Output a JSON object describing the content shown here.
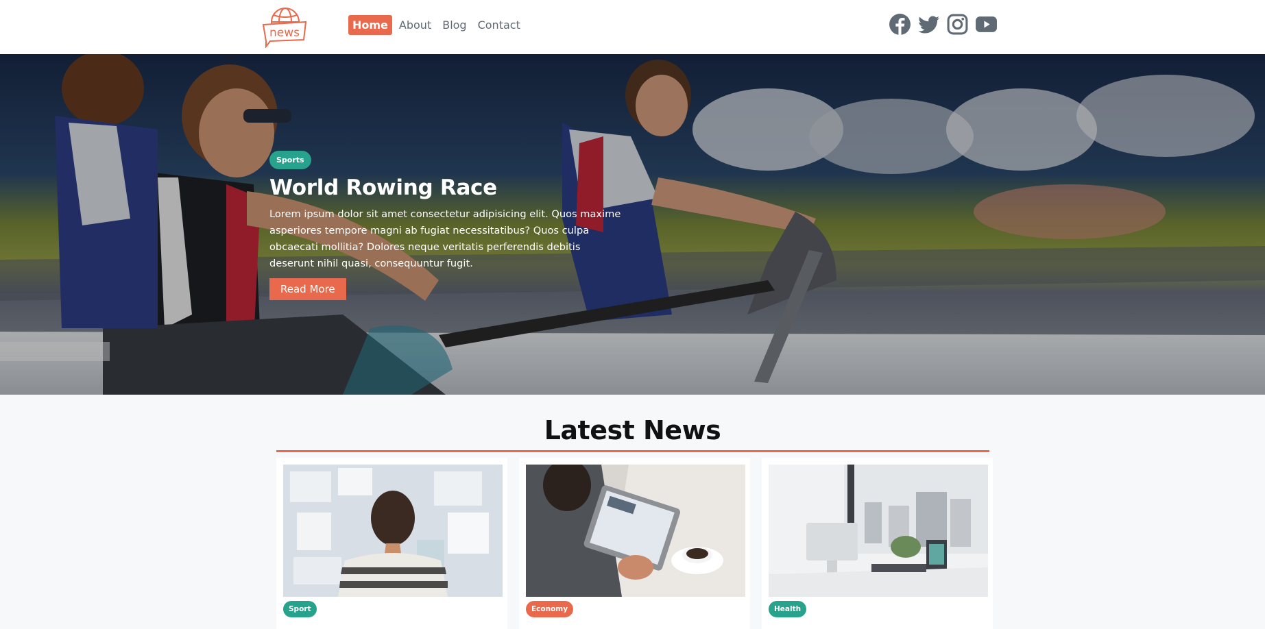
{
  "header": {
    "logo_text": "news",
    "nav": [
      {
        "label": "Home",
        "active": true
      },
      {
        "label": "About",
        "active": false
      },
      {
        "label": "Blog",
        "active": false
      },
      {
        "label": "Contact",
        "active": false
      }
    ],
    "socials": [
      "facebook-icon",
      "twitter-icon",
      "instagram-icon",
      "youtube-icon"
    ]
  },
  "hero": {
    "tag": "Sports",
    "title": "World Rowing Race",
    "text": "Lorem ipsum dolor sit amet consectetur adipisicing elit. Quos maxime asperiores tempore magni ab fugiat necessitatibus? Quos culpa obcaecati mollitia? Dolores neque veritatis perferendis debitis deserunt nihil quasi, consequuntur fugit.",
    "button": "Read More"
  },
  "latest": {
    "title": "Latest News",
    "cards": [
      {
        "tag": "Sport",
        "tag_color": "#26a28d"
      },
      {
        "tag": "Economy",
        "tag_color": "#e8694c"
      },
      {
        "tag": "Health",
        "tag_color": "#26a28d"
      }
    ]
  },
  "colors": {
    "accent": "#e8694c",
    "teal": "#26a28d"
  }
}
